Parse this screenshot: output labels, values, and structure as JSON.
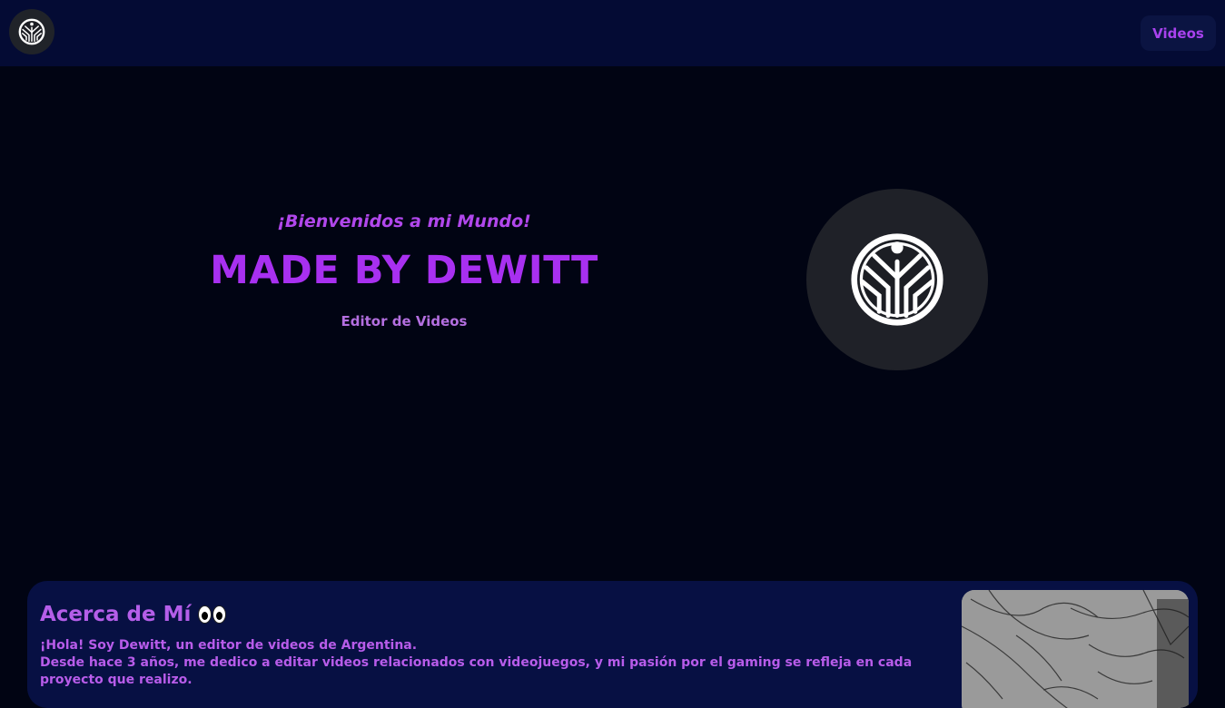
{
  "navbar": {
    "logo_icon": "dewitt-logo-icon",
    "videos_label": "Videos"
  },
  "hero": {
    "welcome": "¡Bienvenidos a mi Mundo!",
    "title": "MADE BY DEWITT",
    "subtitle": "Editor de Videos",
    "avatar_icon": "dewitt-logo-icon"
  },
  "about": {
    "title": "Acerca de Mí",
    "title_icon": "eyes-emoji",
    "line1": "¡Hola! Soy Dewitt, un editor de videos de Argentina.",
    "line2": "Desde hace 3 años, me dedico a editar videos relacionados con videojuegos, y mi pasión por el gaming se refleja en cada proyecto que realizo.",
    "image_icon": "manga-character-image"
  },
  "colors": {
    "background": "#010413",
    "navbar": "#040b34",
    "accent": "#a830f0",
    "card": "#071043"
  }
}
